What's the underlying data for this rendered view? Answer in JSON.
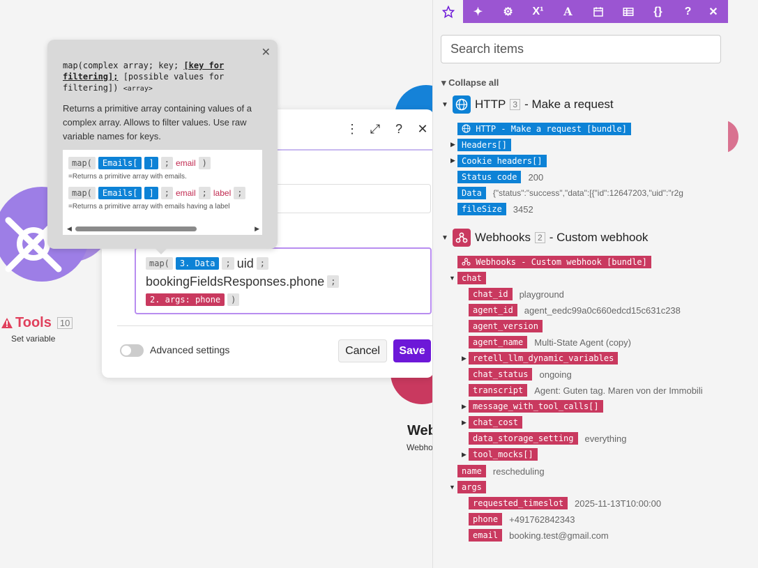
{
  "tooltip": {
    "sig_fn": "map(complex array; key; ",
    "sig_opt": "[key for filtering];",
    "sig_rest": " [possible values for filtering])",
    "sig_ret": "<array>",
    "description": "Returns a primitive array containing values of a complex array. Allows to filter values. Use raw variable names for keys.",
    "examples": [
      {
        "fn": "map(",
        "arr": "Emails[",
        "close": "]",
        "sep": ";",
        "key": "email",
        "end": ")",
        "note": "=Returns a primitive array with emails."
      },
      {
        "fn": "map(",
        "arr": "Emails[",
        "close": "]",
        "sep": ";",
        "key": "email",
        "sep2": ";",
        "label": "label",
        "sep3": ";",
        "note": "=Returns a primitive array with emails having a label"
      }
    ]
  },
  "formula": {
    "fn": "map(",
    "data_pill": "3. Data",
    "sep": ";",
    "key": "uid",
    "path": "bookingFieldsResponses.phone",
    "args_pill": "2. args: phone",
    "close": ")"
  },
  "dialog": {
    "advanced_label": "Advanced settings",
    "cancel": "Cancel",
    "save": "Save"
  },
  "canvas": {
    "tools_title": "Tools",
    "tools_count": "10",
    "tools_sub": "Set variable",
    "web_title": "Web",
    "web_sub": "Webho"
  },
  "panel": {
    "search_placeholder": "Search items",
    "collapse_all": "Collapse all",
    "http": {
      "title": "HTTP",
      "badge": "3",
      "subtitle": "- Make a request",
      "items": [
        {
          "key": "HTTP - Make a request [bundle]",
          "value": ""
        },
        {
          "key": "Headers[]",
          "value": ""
        },
        {
          "key": "Cookie headers[]",
          "value": ""
        },
        {
          "key": "Status code",
          "value": "200"
        },
        {
          "key": "Data",
          "value": "{\"status\":\"success\",\"data\":[{\"id\":12647203,\"uid\":\"r2g"
        },
        {
          "key": "fileSize",
          "value": "3452"
        }
      ]
    },
    "webhooks": {
      "title": "Webhooks",
      "badge": "2",
      "subtitle": "- Custom webhook",
      "bundle": "Webhooks - Custom webhook [bundle]",
      "chat": "chat",
      "chat_items": [
        {
          "key": "chat_id",
          "value": "playground"
        },
        {
          "key": "agent_id",
          "value": "agent_eedc99a0c660edcd15c631c238"
        },
        {
          "key": "agent_version",
          "value": ""
        },
        {
          "key": "agent_name",
          "value": "Multi-State Agent (copy)"
        },
        {
          "key": "retell_llm_dynamic_variables",
          "value": ""
        },
        {
          "key": "chat_status",
          "value": "ongoing"
        },
        {
          "key": "transcript",
          "value": "Agent: Guten tag. Maren von der Immobili"
        },
        {
          "key": "message_with_tool_calls[]",
          "value": ""
        },
        {
          "key": "chat_cost",
          "value": ""
        },
        {
          "key": "data_storage_setting",
          "value": "everything"
        },
        {
          "key": "tool_mocks[]",
          "value": ""
        }
      ],
      "name_key": "name",
      "name_value": "rescheduling",
      "args": "args",
      "args_items": [
        {
          "key": "requested_timeslot",
          "value": "2025-11-13T10:00:00"
        },
        {
          "key": "phone",
          "value": "+491762842343"
        },
        {
          "key": "email",
          "value": "booking.test@gmail.com"
        }
      ]
    }
  },
  "colors": {
    "accent_purple": "#6d18d8",
    "tab_purple": "#9b55d2",
    "pill_blue": "#0d82d6",
    "pill_red": "#c9395f"
  },
  "icons": [
    "star-icon",
    "sparkle-icon",
    "gear-icon",
    "superscript-icon",
    "text-icon",
    "calendar-icon",
    "table-icon",
    "braces-icon",
    "help-icon",
    "close-icon"
  ]
}
